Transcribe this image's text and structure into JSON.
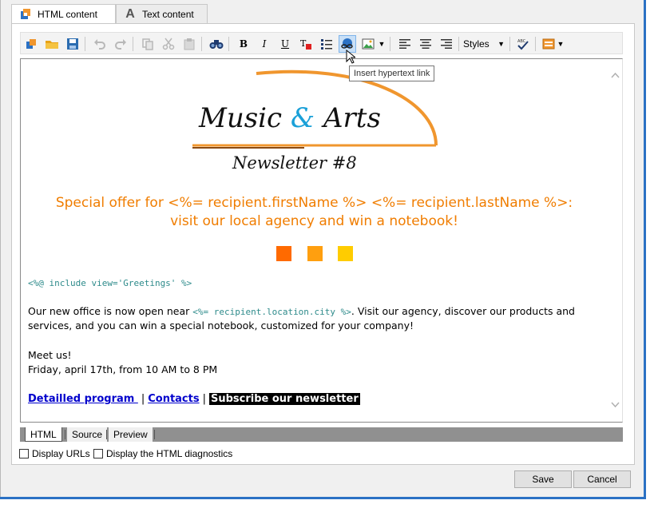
{
  "tabs": [
    {
      "label": "HTML content",
      "icon": "html-content-icon",
      "active": true
    },
    {
      "label": "Text content",
      "icon": "text-content-icon",
      "active": false
    }
  ],
  "toolbar": {
    "styles_label": "Styles",
    "tooltip": "Insert hypertext link"
  },
  "logo": {
    "title_left": "Music",
    "title_amp": "&",
    "title_right": "Arts",
    "subtitle": "Newsletter #8",
    "accent_color": "#f0962e",
    "amp_color": "#1aa0d8"
  },
  "content": {
    "offer_line1": "Special offer for <%= recipient.firstName %> <%= recipient.lastName %>:",
    "offer_line2": "visit our local agency and win a notebook!",
    "square_colors": [
      "#ff6a00",
      "#ff9f0f",
      "#ffcc00"
    ],
    "include_code": "<%@ include view='Greetings' %>",
    "para_part1": "Our new office is now open near ",
    "para_code": "<%= recipient.location.city %>",
    "para_part2": ". Visit our agency, discover our products and",
    "para_line2": "services, and you can win a special notebook, customized for your company!",
    "meet": "Meet us!",
    "date": "Friday, april 17th, from 10 AM to 8 PM",
    "link_program": "Detailled program ",
    "link_contacts": "Contacts",
    "link_subscribe": "Subscribe our newsletter",
    "pipe": "|"
  },
  "mode_tabs": [
    "HTML",
    "Source",
    "Preview"
  ],
  "options": {
    "display_urls": "Display URLs",
    "display_diagnostics": "Display the HTML diagnostics"
  },
  "buttons": {
    "save": "Save",
    "cancel": "Cancel"
  }
}
